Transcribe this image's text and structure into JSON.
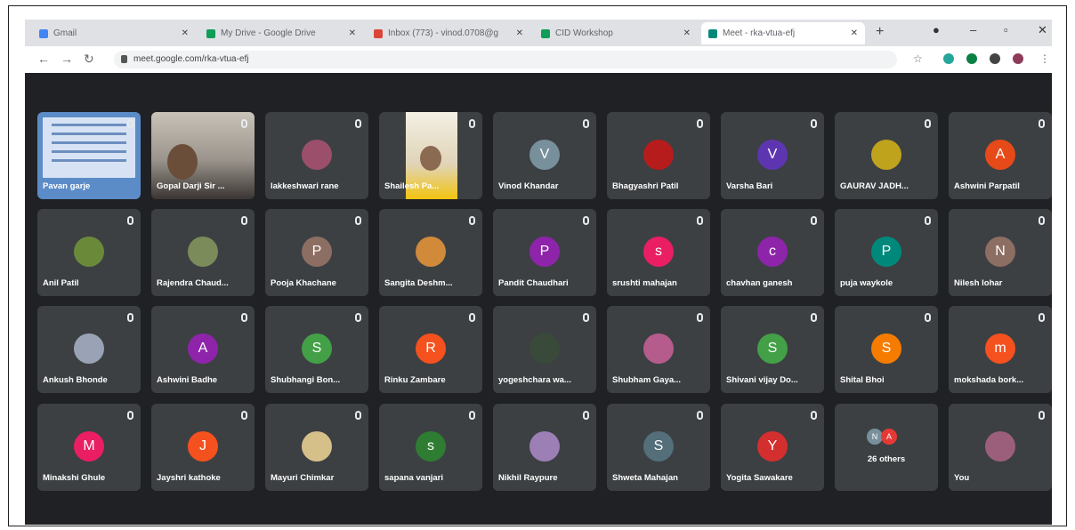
{
  "browser": {
    "tabs": [
      {
        "label": "Gmail",
        "color": "#4285f4",
        "active": false
      },
      {
        "label": "My Drive - Google Drive",
        "color": "#0f9d58",
        "active": false
      },
      {
        "label": "Inbox (773) - vinod.0708@g",
        "color": "#db4437",
        "active": false
      },
      {
        "label": "CID Workshop",
        "color": "#0f9d58",
        "active": false
      },
      {
        "label": "Meet - rka-vtua-efj",
        "color": "#00897b",
        "active": true
      }
    ],
    "new_tab": "+",
    "url": "meet.google.com/rka-vtua-efj"
  },
  "participants": [
    {
      "name": "Pavan garje",
      "kind": "slide",
      "color": "#5b8cc8"
    },
    {
      "name": "Gopal Darji Sir ...",
      "kind": "camera",
      "color": "#8d6e63"
    },
    {
      "name": "lakkeshwari rane",
      "initial": "",
      "kind": "photo",
      "color": "#9c4f6b"
    },
    {
      "name": "Shailesh Pa...",
      "kind": "camera2",
      "color": "#c8a24a"
    },
    {
      "name": "Vinod Khandar",
      "initial": "V",
      "kind": "letter",
      "color": "#78909c"
    },
    {
      "name": "Bhagyashri Patil",
      "initial": "",
      "kind": "photo",
      "color": "#b71c1c"
    },
    {
      "name": "Varsha Bari",
      "initial": "V",
      "kind": "letter",
      "color": "#5e35b1"
    },
    {
      "name": "GAURAV JADH...",
      "initial": "",
      "kind": "photo",
      "color": "#c0a31c"
    },
    {
      "name": "Ashwini Parpatil",
      "initial": "A",
      "kind": "letter",
      "color": "#e64a19"
    },
    {
      "name": "Anil Patil",
      "initial": "",
      "kind": "photo",
      "color": "#6a8a3a"
    },
    {
      "name": "Rajendra Chaud...",
      "initial": "",
      "kind": "photo",
      "color": "#7b8b5a"
    },
    {
      "name": "Pooja Khachane",
      "initial": "P",
      "kind": "letter",
      "color": "#8d6e63"
    },
    {
      "name": "Sangita Deshm...",
      "initial": "",
      "kind": "photo",
      "color": "#d08a3a"
    },
    {
      "name": "Pandit Chaudhari",
      "initial": "P",
      "kind": "letter",
      "color": "#8e24aa"
    },
    {
      "name": "srushti mahajan",
      "initial": "s",
      "kind": "letter",
      "color": "#e91e63"
    },
    {
      "name": "chavhan ganesh",
      "initial": "c",
      "kind": "letter",
      "color": "#8e24aa"
    },
    {
      "name": "puja waykole",
      "initial": "P",
      "kind": "letter",
      "color": "#00897b"
    },
    {
      "name": "Nilesh lohar",
      "initial": "N",
      "kind": "letter",
      "color": "#8d6e63"
    },
    {
      "name": "Ankush Bhonde",
      "initial": "",
      "kind": "photo",
      "color": "#9aa3b5"
    },
    {
      "name": "Ashwini Badhe",
      "initial": "A",
      "kind": "letter",
      "color": "#8e24aa"
    },
    {
      "name": "Shubhangi Bon...",
      "initial": "S",
      "kind": "letter",
      "color": "#43a047"
    },
    {
      "name": "Rinku Zambare",
      "initial": "R",
      "kind": "letter",
      "color": "#f4511e"
    },
    {
      "name": "yogeshchara wa...",
      "initial": "",
      "kind": "photo",
      "color": "#3a4a3a"
    },
    {
      "name": "Shubham Gaya...",
      "initial": "",
      "kind": "photo",
      "color": "#b55c8c"
    },
    {
      "name": "Shivani vijay Do...",
      "initial": "S",
      "kind": "letter",
      "color": "#43a047"
    },
    {
      "name": "Shital Bhoi",
      "initial": "S",
      "kind": "letter",
      "color": "#f57c00"
    },
    {
      "name": "mokshada bork...",
      "initial": "m",
      "kind": "letter",
      "color": "#f4511e"
    },
    {
      "name": "Minakshi Ghule",
      "initial": "M",
      "kind": "letter",
      "color": "#e91e63"
    },
    {
      "name": "Jayshri kathoke",
      "initial": "J",
      "kind": "letter",
      "color": "#f4511e"
    },
    {
      "name": "Mayuri Chimkar",
      "initial": "",
      "kind": "photo",
      "color": "#d6c08a"
    },
    {
      "name": "sapana vanjari",
      "initial": "s",
      "kind": "letter",
      "color": "#2e7d32"
    },
    {
      "name": "Nikhil Raypure",
      "initial": "",
      "kind": "photo",
      "color": "#9c7fb5"
    },
    {
      "name": "Shweta Mahajan",
      "initial": "S",
      "kind": "letter",
      "color": "#546e7a"
    },
    {
      "name": "Yogita Sawakare",
      "initial": "Y",
      "kind": "letter",
      "color": "#d32f2f"
    },
    {
      "name": "26 others",
      "kind": "others",
      "color": "#5e35b1"
    },
    {
      "name": "You",
      "initial": "",
      "kind": "photo",
      "color": "#9c5f7b"
    }
  ],
  "others_initials": [
    "N",
    "A"
  ],
  "others_colors": [
    "#78909c",
    "#e53935"
  ]
}
